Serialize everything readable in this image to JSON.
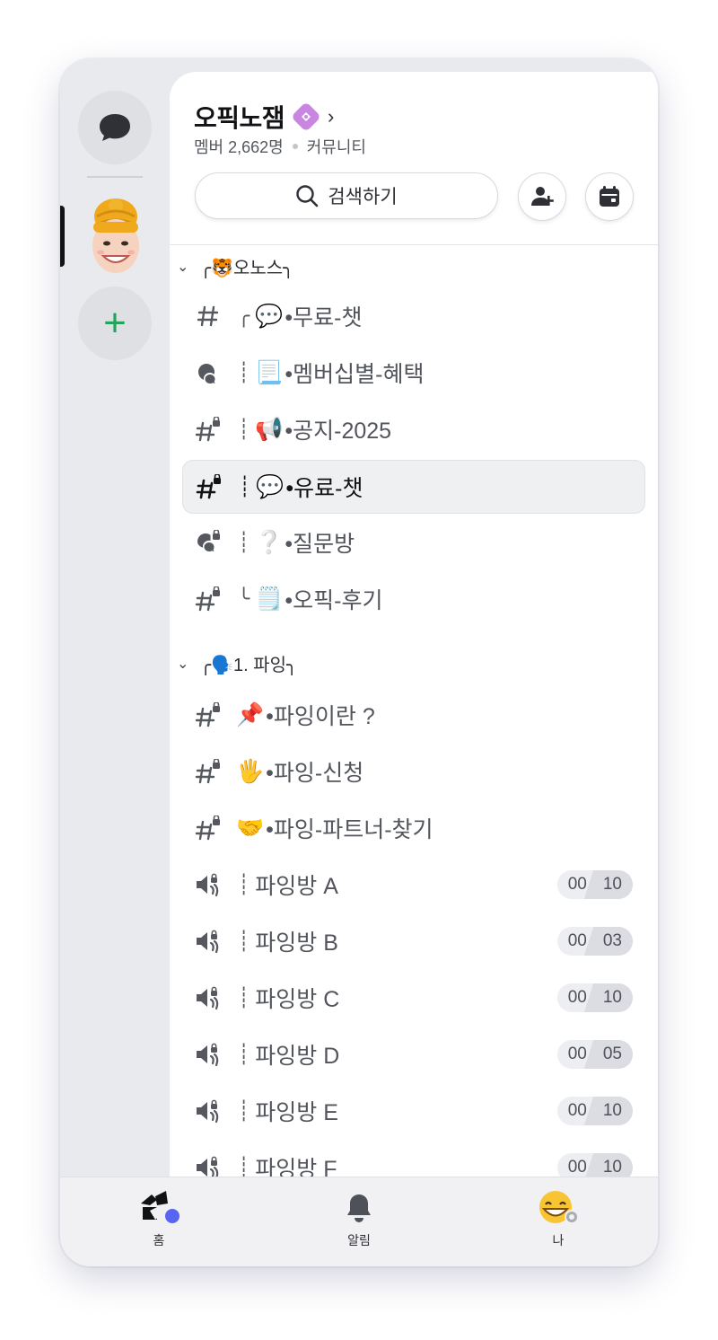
{
  "server": {
    "name": "오픽노잼",
    "member_count": "멤버 2,662명",
    "type": "커뮤니티",
    "search_label": "검색하기"
  },
  "categories": [
    {
      "title": "╭🐯오노스╮",
      "channels": [
        {
          "icon": "hashtag-icon",
          "prefix": "╭",
          "emoji": "💬",
          "name": "•무료-챗"
        },
        {
          "icon": "forum-icon",
          "prefix": "┊",
          "emoji": "📃",
          "name": "•멤버십별-혜택"
        },
        {
          "icon": "locked-hashtag-icon",
          "prefix": "┊",
          "emoji": "📢",
          "name": "•공지-2025"
        },
        {
          "icon": "locked-hashtag-icon",
          "prefix": "┊",
          "emoji": "💬",
          "name": "•유료-챗",
          "active": true
        },
        {
          "icon": "locked-forum-icon",
          "prefix": "┊",
          "emoji": "❔",
          "name": "•질문방"
        },
        {
          "icon": "locked-hashtag-icon",
          "prefix": "╰",
          "emoji": "🗒️",
          "name": "•오픽-후기"
        }
      ]
    },
    {
      "title": "╭🗣️1. 파잉╮",
      "channels": [
        {
          "icon": "locked-hashtag-icon",
          "emoji": "📌",
          "name": "•파잉이란 ?"
        },
        {
          "icon": "locked-hashtag-icon",
          "emoji": "🖐️",
          "name": "•파잉-신청"
        },
        {
          "icon": "locked-hashtag-icon",
          "emoji": "🤝",
          "name": "•파잉-파트너-찾기"
        }
      ]
    }
  ],
  "voice_channels": [
    {
      "name": "파잉방 A",
      "current": "00",
      "limit": "10"
    },
    {
      "name": "파잉방 B",
      "current": "00",
      "limit": "03"
    },
    {
      "name": "파잉방 C",
      "current": "00",
      "limit": "10"
    },
    {
      "name": "파잉방 D",
      "current": "00",
      "limit": "05"
    },
    {
      "name": "파잉방 E",
      "current": "00",
      "limit": "10"
    },
    {
      "name": "파잉방 F",
      "current": "00",
      "limit": "10"
    }
  ],
  "bottom_nav": {
    "home": "홈",
    "notifications": "알림",
    "me": "나"
  },
  "colors": {
    "accent_green": "#23a55a",
    "boost_pink": "#c986e0",
    "notify_blue": "#5865f2"
  }
}
